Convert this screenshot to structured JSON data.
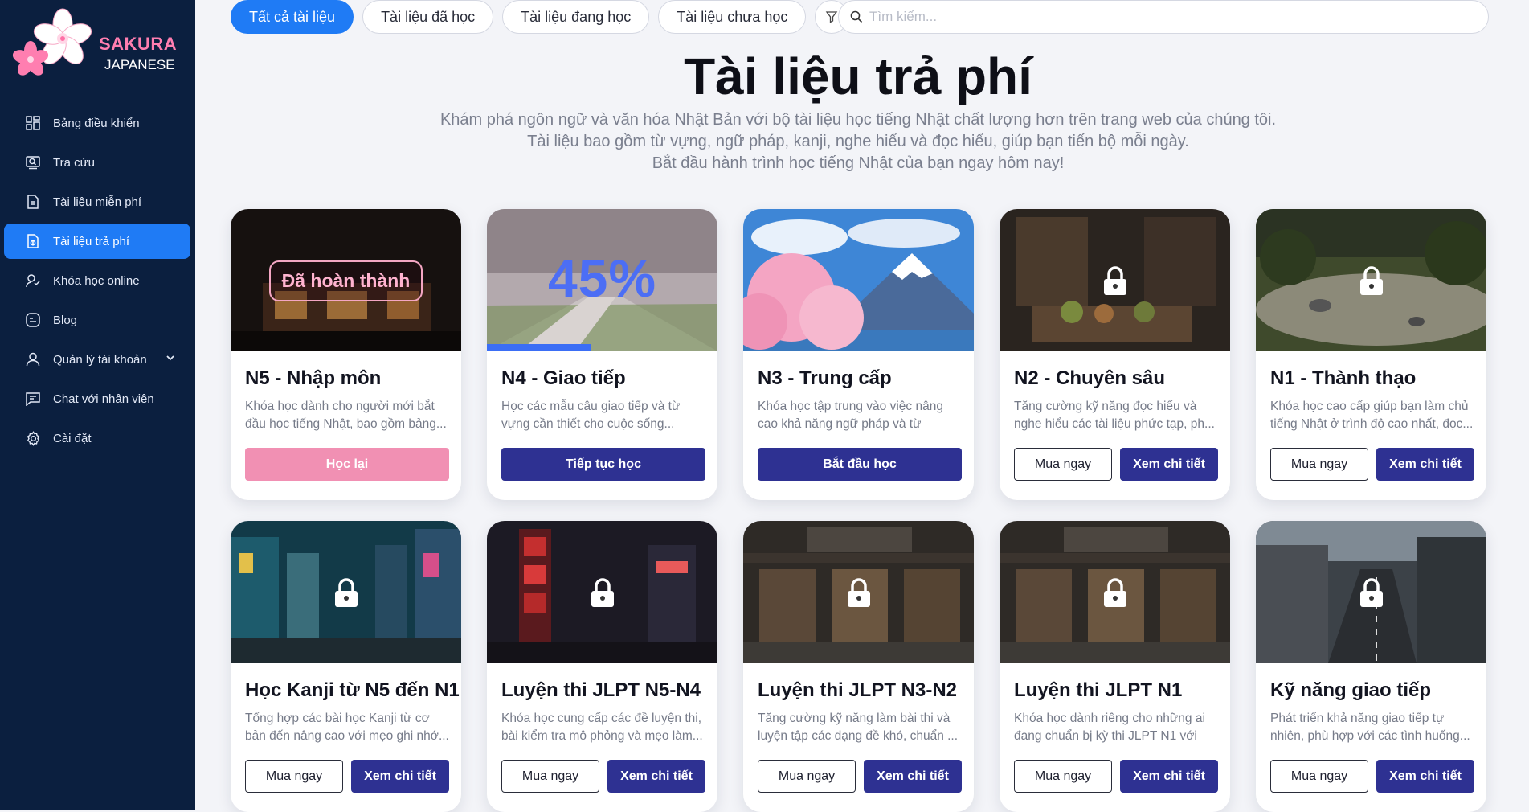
{
  "brand": {
    "line1": "SAKURA",
    "line2": "JAPANESE",
    "accent": "#ff7eb0"
  },
  "sidebar": {
    "items": [
      {
        "label": "Bảng điều khiển",
        "icon": "dashboard-icon"
      },
      {
        "label": "Tra cứu",
        "icon": "search-book-icon"
      },
      {
        "label": "Tài liệu miễn phí",
        "icon": "document-icon"
      },
      {
        "label": "Tài liệu trả phí",
        "icon": "paid-document-icon",
        "active": true
      },
      {
        "label": "Khóa học online",
        "icon": "online-course-icon"
      },
      {
        "label": "Blog",
        "icon": "blog-icon"
      },
      {
        "label": "Quản lý tài khoản",
        "icon": "user-icon",
        "has_submenu": true
      },
      {
        "label": "Chat với nhân viên",
        "icon": "chat-icon"
      },
      {
        "label": "Cài đặt",
        "icon": "gear-icon"
      }
    ]
  },
  "filters": {
    "tabs": [
      "Tất cả tài liệu",
      "Tài liệu đã học",
      "Tài liệu đang học",
      "Tài liệu chưa học"
    ],
    "active_index": 0,
    "search_placeholder": "Tìm kiếm..."
  },
  "header": {
    "title": "Tài liệu trả phí",
    "subtitle_lines": [
      "Khám phá ngôn ngữ và văn hóa Nhật Bản với bộ tài liệu học tiếng Nhật chất lượng hơn trên trang web của chúng tôi.",
      "Tài liệu bao gồm từ vựng, ngữ pháp, kanji, nghe hiểu và đọc hiểu, giúp bạn tiến bộ mỗi ngày.",
      "Bắt đầu hành trình học tiếng Nhật của bạn ngay hôm nay!"
    ]
  },
  "cards": [
    {
      "title": "N5 - Nhập môn",
      "desc": "Khóa học dành cho người mới bắt đầu học tiếng Nhật, bao gồm bảng...",
      "status": "completed",
      "badge": "Đã hoàn thành",
      "action": "Học lại",
      "scene": "night-shop"
    },
    {
      "title": "N4 - Giao tiếp",
      "desc": "Học các mẫu câu giao tiếp và từ vựng cần thiết cho cuộc sống...",
      "status": "in-progress",
      "progress_label": "45%",
      "progress": 0.45,
      "action": "Tiếp tục học",
      "scene": "cherry-path"
    },
    {
      "title": "N3 - Trung cấp",
      "desc": "Khóa học tập trung vào việc nâng cao khả năng ngữ pháp và từ vựng...",
      "status": "unlocked",
      "action": "Bắt đầu học",
      "scene": "fuji"
    },
    {
      "title": "N2 - Chuyên sâu",
      "desc": "Tăng cường kỹ năng đọc hiểu và nghe hiểu các tài liệu phức tạp, ph...",
      "status": "locked",
      "buy": "Mua ngay",
      "detail": "Xem chi tiết",
      "scene": "kitchen"
    },
    {
      "title": "N1 - Thành thạo",
      "desc": "Khóa học cao cấp giúp bạn làm chủ tiếng Nhật ở trình độ cao nhất, đọc...",
      "status": "locked",
      "buy": "Mua ngay",
      "detail": "Xem chi tiết",
      "scene": "garden"
    },
    {
      "title": "Học Kanji từ N5 đến N1",
      "desc": "Tổng hợp các bài học Kanji từ cơ bản đến nâng cao với mẹo ghi nhớ...",
      "status": "locked",
      "buy": "Mua ngay",
      "detail": "Xem chi tiết",
      "scene": "city-night"
    },
    {
      "title": "Luyện thi JLPT N5-N4",
      "desc": "Khóa học cung cấp các đề luyện thi, bài kiểm tra mô phỏng và mẹo làm...",
      "status": "locked",
      "buy": "Mua ngay",
      "detail": "Xem chi tiết",
      "scene": "neon-street"
    },
    {
      "title": "Luyện thi JLPT N3-N2",
      "desc": "Tăng cường kỹ năng làm bài thi và luyện tập các dạng đề khó, chuẩn ...",
      "status": "locked",
      "buy": "Mua ngay",
      "detail": "Xem chi tiết",
      "scene": "storefront"
    },
    {
      "title": "Luyện thi JLPT N1",
      "desc": "Khóa học dành riêng cho những ai đang chuẩn bị kỳ thi JLPT N1 với cá...",
      "status": "locked",
      "buy": "Mua ngay",
      "detail": "Xem chi tiết",
      "scene": "storefront"
    },
    {
      "title": "Kỹ năng giao tiếp",
      "desc": "Phát triển khả năng giao tiếp tự nhiên, phù hợp với các tình huống...",
      "status": "locked",
      "buy": "Mua ngay",
      "detail": "Xem chi tiết",
      "scene": "alley"
    }
  ]
}
